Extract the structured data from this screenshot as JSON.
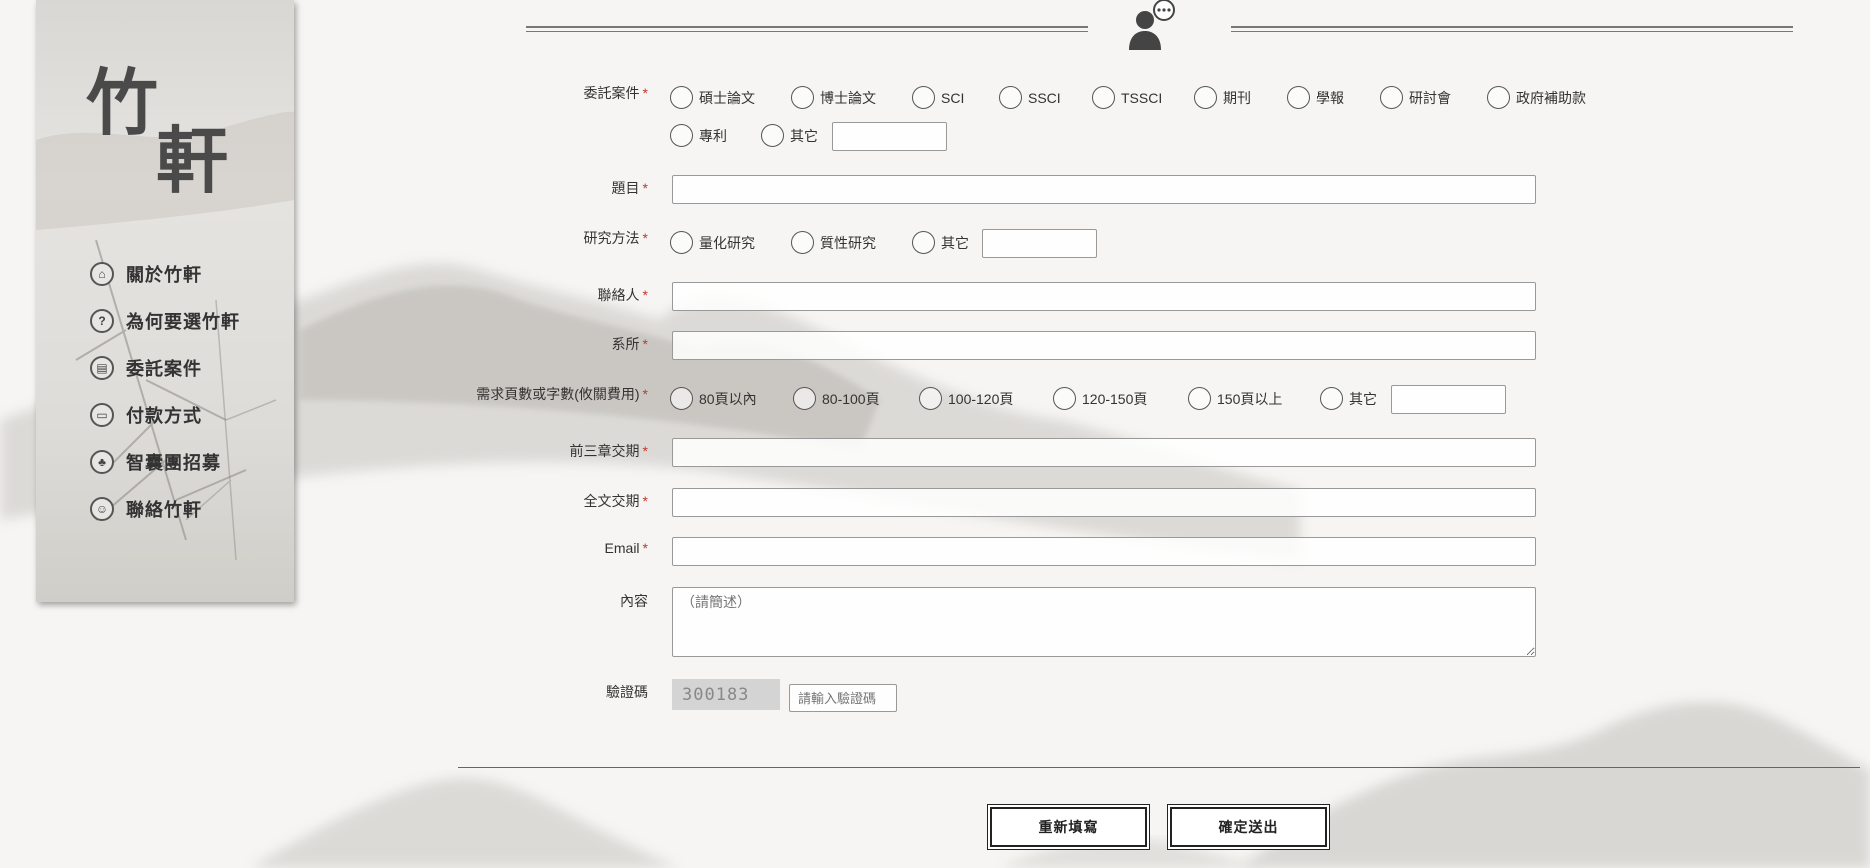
{
  "sidebar": {
    "logo_line1": "竹",
    "logo_line2": "軒",
    "items": [
      {
        "label": "關於竹軒",
        "icon": "home-icon",
        "glyph": "⌂"
      },
      {
        "label": "為何要選竹軒",
        "icon": "question-icon",
        "glyph": "?"
      },
      {
        "label": "委託案件",
        "icon": "document-icon",
        "glyph": "▤"
      },
      {
        "label": "付款方式",
        "icon": "payment-icon",
        "glyph": "▭"
      },
      {
        "label": "智囊團招募",
        "icon": "team-icon",
        "glyph": "♣"
      },
      {
        "label": "聯絡竹軒",
        "icon": "contact-icon",
        "glyph": "☺"
      }
    ]
  },
  "form": {
    "case_type": {
      "label": "委託案件",
      "options": [
        "碩士論文",
        "博士論文",
        "SCI",
        "SSCI",
        "TSSCI",
        "期刊",
        "學報",
        "研討會",
        "政府補助款",
        "專利",
        "其它"
      ]
    },
    "title": {
      "label": "題目"
    },
    "method": {
      "label": "研究方法",
      "options": [
        "量化研究",
        "質性研究",
        "其它"
      ]
    },
    "contact": {
      "label": "聯絡人"
    },
    "department": {
      "label": "系所"
    },
    "pages": {
      "label": "需求頁數或字數(攸關費用)",
      "options": [
        "80頁以內",
        "80-100頁",
        "100-120頁",
        "120-150頁",
        "150頁以上",
        "其它"
      ]
    },
    "first3_deadline": {
      "label": "前三章交期"
    },
    "full_deadline": {
      "label": "全文交期"
    },
    "email": {
      "label": "Email"
    },
    "content": {
      "label": "內容",
      "placeholder": "（請簡述）"
    },
    "captcha": {
      "label": "驗證碼",
      "code": "300183",
      "placeholder": "請輸入驗證碼"
    },
    "required_mark": "*"
  },
  "buttons": {
    "reset": "重新填寫",
    "submit": "確定送出"
  }
}
